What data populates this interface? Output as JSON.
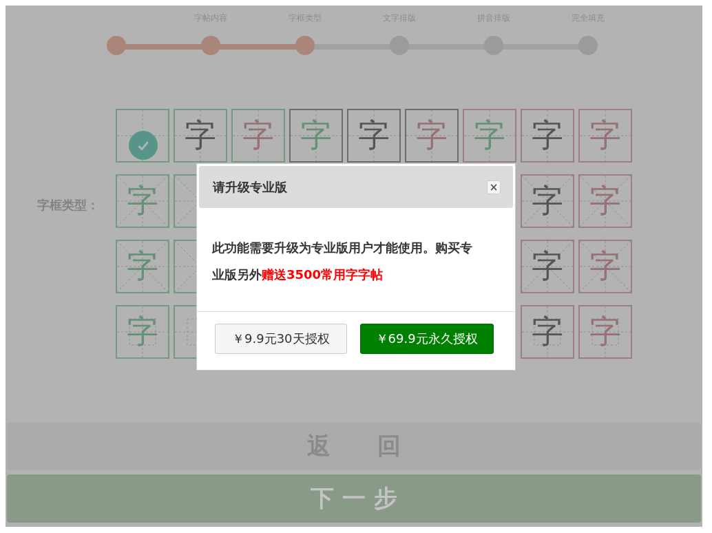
{
  "steps": [
    {
      "done": true
    },
    {
      "label": "字帖内容",
      "done": true
    },
    {
      "label": "字框类型",
      "done": true
    },
    {
      "label": "文字排版",
      "done": false
    },
    {
      "label": "拼音排版",
      "done": false
    },
    {
      "label": "完全填充",
      "done": false
    }
  ],
  "frame_type_label": "字框类型：",
  "frame_rows": [
    {
      "kind": "cross",
      "cells": [
        {
          "kind": "green",
          "selected": true
        },
        {
          "char": "字",
          "color": "#555555",
          "kind": "green",
          "selected": false
        },
        {
          "char": "字",
          "color": "#967076",
          "kind": "green",
          "selected": false
        },
        {
          "char": "字",
          "color": "#649174",
          "kind": "grey",
          "selected": false
        },
        {
          "char": "字",
          "color": "#555555",
          "kind": "grey",
          "selected": false
        },
        {
          "char": "字",
          "color": "#967076",
          "kind": "grey",
          "selected": false
        },
        {
          "char": "字",
          "color": "#649174",
          "kind": "rose",
          "selected": false
        },
        {
          "char": "字",
          "color": "#555555",
          "kind": "rose",
          "selected": false
        },
        {
          "char": "字",
          "color": "#967076",
          "kind": "rose",
          "selected": false
        }
      ]
    },
    {
      "kind": "mi",
      "cells": [
        {
          "char": "字",
          "color": "#649174",
          "kind": "green",
          "selected": false
        },
        {
          "kind": "green",
          "selected": false
        },
        {},
        {},
        {},
        {},
        {},
        {
          "char": "字",
          "color": "#555555",
          "kind": "rose",
          "selected": false
        },
        {
          "char": "字",
          "color": "#967076",
          "kind": "rose",
          "selected": false
        }
      ]
    },
    {
      "kind": "mi",
      "cells": [
        {
          "char": "字",
          "color": "#649174",
          "kind": "green",
          "selected": false
        },
        {
          "kind": "green",
          "selected": false
        },
        {},
        {},
        {},
        {},
        {},
        {
          "char": "字",
          "color": "#555555",
          "kind": "rose",
          "selected": false
        },
        {
          "char": "字",
          "color": "#967076",
          "kind": "rose",
          "selected": false
        }
      ]
    },
    {
      "kind": "square",
      "cells": [
        {
          "char": "字",
          "color": "#649174",
          "kind": "green",
          "selected": false
        },
        {
          "kind": "green",
          "selected": false
        },
        {},
        {},
        {},
        {},
        {},
        {
          "char": "字",
          "color": "#555555",
          "kind": "rose",
          "selected": false
        },
        {
          "char": "字",
          "color": "#967076",
          "kind": "rose",
          "selected": false
        }
      ]
    }
  ],
  "back_button": "返　　回",
  "next_button": "下 一 步",
  "dialog": {
    "title": "请升级专业版",
    "close": "×",
    "message": "此功能需要升级为专业版用户才能使用。购买专业版另外**赠送3500常用字字帖**",
    "buttons": [
      {
        "label": "￥9.9元30天授权",
        "kind": "secondary"
      },
      {
        "label": "￥69.9元永久授权",
        "kind": "primary"
      }
    ]
  }
}
